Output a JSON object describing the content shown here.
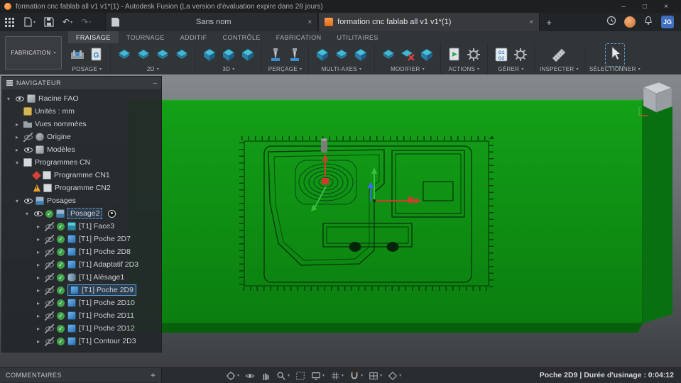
{
  "title_bar": {
    "title": "formation cnc fablab all v1 v1*(1) - Autodesk Fusion (La version d'évaluation expire dans 28 jours)"
  },
  "tab_bar": {
    "documents": [
      {
        "title": "Sans nom"
      },
      {
        "title": "formation cnc fablab all v1 v1*(1)"
      }
    ],
    "avatar_initials": "JG"
  },
  "ribbon": {
    "workspace_label": "FABRICATION",
    "tabs": [
      {
        "label": "FRAISAGE"
      },
      {
        "label": "TOURNAGE"
      },
      {
        "label": "ADDITIF"
      },
      {
        "label": "CONTRÔLE"
      },
      {
        "label": "FABRICATION"
      },
      {
        "label": "UTILITAIRES"
      }
    ],
    "groups": [
      {
        "label": "POSAGE"
      },
      {
        "label": "2D"
      },
      {
        "label": "3D"
      },
      {
        "label": "PERÇAGE"
      },
      {
        "label": "MULTI-AXES"
      },
      {
        "label": "MODIFIER"
      },
      {
        "label": "ACTIONS"
      },
      {
        "label": "GÉRER"
      },
      {
        "label": "INSPECTER"
      },
      {
        "label": "SÉLECTIONNER"
      }
    ]
  },
  "navigator": {
    "header": "NAVIGATEUR",
    "items": [
      {
        "label": "Racine FAO"
      },
      {
        "label": "Unités : mm"
      },
      {
        "label": "Vues nommées"
      },
      {
        "label": "Origine"
      },
      {
        "label": "Modèles"
      },
      {
        "label": "Programmes CN"
      },
      {
        "label": "Programme CN1"
      },
      {
        "label": "Programme CN2"
      },
      {
        "label": "Posages"
      },
      {
        "label": "Posage2"
      },
      {
        "label": "[T1] Face3"
      },
      {
        "label": "[T1] Poche 2D7"
      },
      {
        "label": "[T1] Poche 2D8"
      },
      {
        "label": "[T1] Adaptatif 2D3"
      },
      {
        "label": "[T1] Alésage1"
      },
      {
        "label": "[T1] Poche 2D9"
      },
      {
        "label": "[T1] Poche 2D10"
      },
      {
        "label": "[T1] Poche 2D11"
      },
      {
        "label": "[T1] Poche 2D12"
      },
      {
        "label": "[T1] Contour 2D3"
      }
    ]
  },
  "bottom_bar": {
    "comments_label": "COMMENTAIRES",
    "status": "Poche 2D9 | Durée d'usinage : 0:04:12"
  },
  "icons": {
    "caret_down": "▾",
    "collapse": "▸",
    "expand": "▾",
    "close": "×",
    "minimize": "–",
    "maximize": "□",
    "plus": "+",
    "undo": "↶",
    "redo": "↷",
    "panel_minimize": "–"
  },
  "colors": {
    "stock_green": "#0f9013",
    "accent_blue": "#58a0dc",
    "check_green": "#3fa24a",
    "error_red": "#d8403a",
    "warning_orange": "#eda22d"
  }
}
